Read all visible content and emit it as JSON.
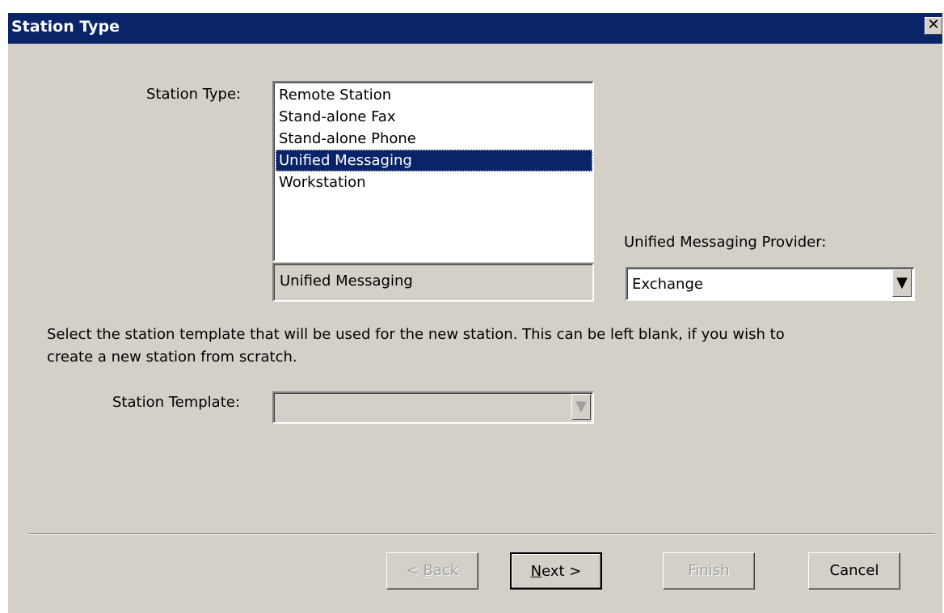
{
  "dialog": {
    "title": "Station Type",
    "close_glyph": "✕"
  },
  "station_type": {
    "label": "Station Type:",
    "items": [
      "Remote Station",
      "Stand-alone Fax",
      "Stand-alone Phone",
      "Unified Messaging",
      "Workstation"
    ],
    "selected_index": 3,
    "selected_display": "Unified Messaging"
  },
  "provider": {
    "label": "Unified Messaging Provider:",
    "value": "Exchange",
    "arrow_icon": "dropdown-arrow-icon"
  },
  "template": {
    "description_line1": "Select the station template that will be used for the new station. This can be left blank, if you wish to",
    "description_line2": "create a new station from scratch.",
    "label": "Station Template:",
    "value": "",
    "enabled": false
  },
  "buttons": {
    "back_prefix": "< ",
    "back_mnemonic": "B",
    "back_rest": "ack",
    "next_mnemonic": "N",
    "next_rest": "ext >",
    "finish": "Finish",
    "cancel": "Cancel"
  }
}
